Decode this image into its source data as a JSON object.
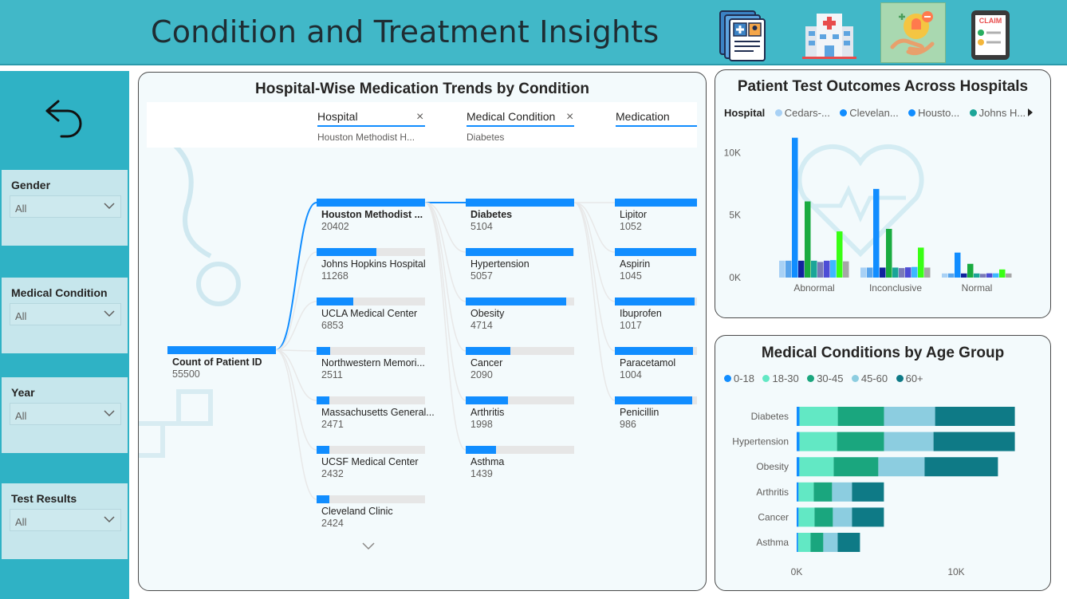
{
  "header": {
    "title": "Condition and Treatment Insights",
    "nav_icons": [
      "medical-records-icon",
      "hospital-icon",
      "care-icon",
      "claim-clipboard-icon"
    ],
    "claim_label": "CLAIM"
  },
  "sidebar": {
    "back_icon": "undo-arrow-icon",
    "filters": [
      {
        "label": "Gender",
        "value": "All"
      },
      {
        "label": "Medical Condition",
        "value": "All"
      },
      {
        "label": "Year",
        "value": "All"
      },
      {
        "label": "Test Results",
        "value": "All"
      }
    ]
  },
  "tree": {
    "title": "Hospital-Wise Medication Trends by Condition",
    "columns": [
      {
        "header": "Hospital",
        "filter": "Houston Methodist H..."
      },
      {
        "header": "Medical Condition",
        "filter": "Diabetes"
      },
      {
        "header": "Medication",
        "filter": ""
      }
    ],
    "root": {
      "label": "Count of Patient ID",
      "value": "55500"
    },
    "hospitals": [
      {
        "label": "Houston Methodist ...",
        "value": "20402",
        "frac": 1.0,
        "selected": true
      },
      {
        "label": "Johns Hopkins Hospital",
        "value": "11268",
        "frac": 0.552
      },
      {
        "label": "UCLA Medical Center",
        "value": "6853",
        "frac": 0.336
      },
      {
        "label": "Northwestern Memori...",
        "value": "2511",
        "frac": 0.123
      },
      {
        "label": "Massachusetts General...",
        "value": "2471",
        "frac": 0.121
      },
      {
        "label": "UCSF Medical Center",
        "value": "2432",
        "frac": 0.119
      },
      {
        "label": "Cleveland Clinic",
        "value": "2424",
        "frac": 0.119
      }
    ],
    "conditions": [
      {
        "label": "Diabetes",
        "value": "5104",
        "frac": 1.0,
        "selected": true
      },
      {
        "label": "Hypertension",
        "value": "5057",
        "frac": 0.991
      },
      {
        "label": "Obesity",
        "value": "4714",
        "frac": 0.924
      },
      {
        "label": "Cancer",
        "value": "2090",
        "frac": 0.41
      },
      {
        "label": "Arthritis",
        "value": "1998",
        "frac": 0.391
      },
      {
        "label": "Asthma",
        "value": "1439",
        "frac": 0.282
      }
    ],
    "medications": [
      {
        "label": "Lipitor",
        "value": "1052",
        "frac": 1.0
      },
      {
        "label": "Aspirin",
        "value": "1045",
        "frac": 0.993
      },
      {
        "label": "Ibuprofen",
        "value": "1017",
        "frac": 0.967
      },
      {
        "label": "Paracetamol",
        "value": "1004",
        "frac": 0.954
      },
      {
        "label": "Penicillin",
        "value": "986",
        "frac": 0.937
      }
    ]
  },
  "chart_data": [
    {
      "type": "bar",
      "title": "Patient Test Outcomes Across Hospitals",
      "legend_title": "Hospital",
      "legend": [
        "Cedars-...",
        "Clevelan...",
        "Housto...",
        "Johns H..."
      ],
      "categories": [
        "Abnormal",
        "Inconclusive",
        "Normal"
      ],
      "y_ticks": [
        "0K",
        "5K",
        "10K"
      ],
      "ylim": [
        0,
        11500
      ],
      "colors": [
        "#a8d1f5",
        "#5aa5ec",
        "#118dff",
        "#12239e",
        "#1aab40",
        "#1ba598",
        "#7a7ab8",
        "#4d4dd6",
        "#3db8ff",
        "#39ff14",
        "#a6a6a6"
      ],
      "series_values": [
        [
          1350,
          800,
          330
        ],
        [
          1350,
          800,
          330
        ],
        [
          11200,
          7100,
          2000
        ],
        [
          1350,
          800,
          330
        ],
        [
          6100,
          3900,
          1100
        ],
        [
          1350,
          800,
          330
        ],
        [
          1250,
          760,
          300
        ],
        [
          1350,
          820,
          340
        ],
        [
          1400,
          850,
          340
        ],
        [
          3700,
          2400,
          650
        ],
        [
          1300,
          800,
          330
        ]
      ]
    },
    {
      "type": "bar",
      "orientation": "horizontal",
      "stacked": true,
      "title": "Medical Conditions by Age Group",
      "categories": [
        "Diabetes",
        "Hypertension",
        "Obesity",
        "Arthritis",
        "Cancer",
        "Asthma"
      ],
      "series": [
        {
          "name": "0-18",
          "color": "#118dff",
          "values": [
            180,
            180,
            170,
            120,
            120,
            90
          ]
        },
        {
          "name": "18-30",
          "color": "#62e8c4",
          "values": [
            2400,
            2350,
            2150,
            950,
            1000,
            780
          ]
        },
        {
          "name": "30-45",
          "color": "#1aa67e",
          "values": [
            2900,
            2950,
            2800,
            1150,
            1150,
            800
          ]
        },
        {
          "name": "45-60",
          "color": "#8ccde0",
          "values": [
            3200,
            3100,
            2900,
            1250,
            1200,
            900
          ]
        },
        {
          "name": "60+",
          "color": "#0e7a86",
          "values": [
            5000,
            5100,
            4600,
            2000,
            2000,
            1400
          ]
        }
      ],
      "x_ticks": [
        "0K",
        "10K"
      ],
      "xlim": [
        0,
        15000
      ]
    }
  ]
}
